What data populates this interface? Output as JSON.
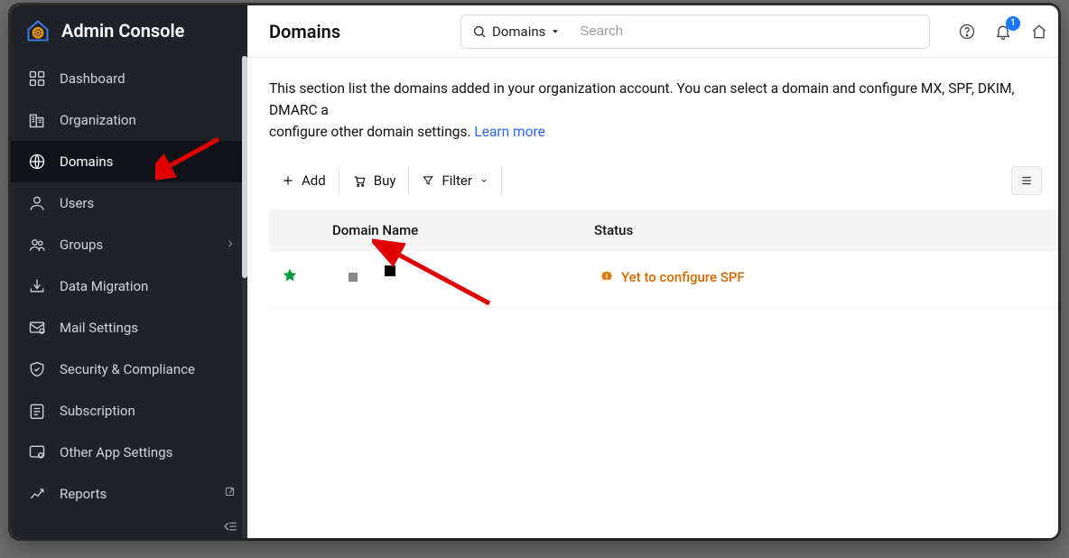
{
  "app_title": "Admin Console",
  "sidebar": {
    "items": [
      {
        "label": "Dashboard",
        "icon": "dashboard-icon"
      },
      {
        "label": "Organization",
        "icon": "organization-icon"
      },
      {
        "label": "Domains",
        "icon": "globe-icon",
        "active": true
      },
      {
        "label": "Users",
        "icon": "user-icon"
      },
      {
        "label": "Groups",
        "icon": "groups-icon",
        "has_children": true
      },
      {
        "label": "Data Migration",
        "icon": "data-migration-icon"
      },
      {
        "label": "Mail Settings",
        "icon": "mail-settings-icon"
      },
      {
        "label": "Security & Compliance",
        "icon": "shield-icon"
      },
      {
        "label": "Subscription",
        "icon": "subscription-icon"
      },
      {
        "label": "Other App Settings",
        "icon": "other-app-settings-icon"
      },
      {
        "label": "Reports",
        "icon": "reports-icon",
        "popout": true
      }
    ]
  },
  "header": {
    "page_title": "Domains",
    "search_scope": "Domains",
    "search_placeholder": "Search",
    "notification_count": "1"
  },
  "intro": {
    "text_a": "This section list the domains added in your organization account. You can select a domain and configure MX, SPF, DKIM, DMARC a",
    "text_b": "configure other domain settings.  ",
    "learn_more": "Learn more"
  },
  "toolbar": {
    "add_label": "Add",
    "buy_label": "Buy",
    "filter_label": "Filter"
  },
  "table": {
    "col_domain": "Domain Name",
    "col_status": "Status"
  },
  "rows": [
    {
      "status_text": "Yet to configure SPF"
    }
  ],
  "colors": {
    "accent_link": "#2a66ff",
    "warning": "#d46a00",
    "success": "#0b9b3e",
    "badge": "#1976ff"
  }
}
